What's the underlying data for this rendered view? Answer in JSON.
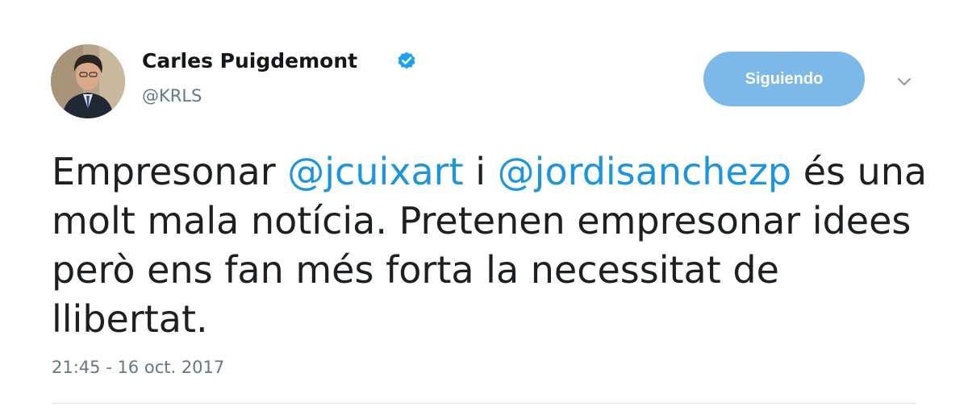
{
  "author": {
    "display_name": "Carles Puigdemont",
    "handle": "@KRLS",
    "verified": true,
    "avatar_icon": "profile-photo"
  },
  "actions": {
    "follow_label": "Siguiendo",
    "menu_icon": "chevron-down-icon"
  },
  "tweet": {
    "text_prefix": "Empresonar ",
    "mention_1": "@jcuixart",
    "text_middle": " i ",
    "mention_2": "@jordisanchezp",
    "text_suffix": " és una molt mala notícia. Pretenen empresonar idees però ens fan més forta la necessitat de llibertat.",
    "timestamp": "21:45 - 16 oct. 2017"
  },
  "colors": {
    "accent": "#1b95e0",
    "follow_button_bg": "#7cb8e8",
    "secondary_text": "#657786",
    "verified_badge": "#1da1f2"
  }
}
